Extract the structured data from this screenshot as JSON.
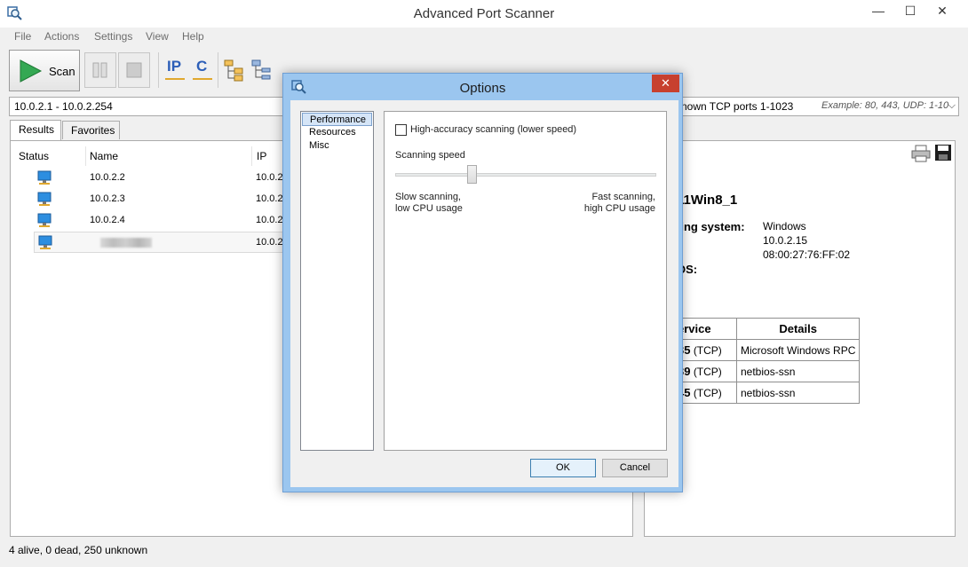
{
  "window": {
    "title": "Advanced Port Scanner",
    "controls": [
      "—",
      "☐",
      "✕"
    ]
  },
  "menu": [
    "File",
    "Actions",
    "Settings",
    "View",
    "Help"
  ],
  "toolbar": {
    "scan_label": "Scan",
    "ip_label": "IP",
    "c_label": "C"
  },
  "range": {
    "value": "10.0.2.1 - 10.0.2.254",
    "ports_text": "nown TCP ports 1-1023",
    "ports_example": "Example: 80, 443, UDP: 1-10"
  },
  "tabs": [
    "Results",
    "Favorites"
  ],
  "results": {
    "columns": [
      "Status",
      "Name",
      "IP"
    ],
    "rows": [
      {
        "name": "10.0.2.2",
        "ip": "10.0.2"
      },
      {
        "name": "10.0.2.3",
        "ip": "10.0.2"
      },
      {
        "name": "10.0.2.4",
        "ip": "10.0.2"
      },
      {
        "name": "",
        "ip": "10.0.2"
      }
    ]
  },
  "details": {
    "host": "11Win8_1",
    "os_label": "ting system:",
    "os_value": "Windows",
    "ip_value": "10.0.2.15",
    "mac_value": "08:00:27:76:FF:02",
    "dns_label": "OS:",
    "table_headers": [
      "ervice",
      "Details"
    ],
    "services": [
      {
        "port": "35",
        "proto": "(TCP)",
        "details": "Microsoft Windows RPC"
      },
      {
        "port": "39",
        "proto": "(TCP)",
        "details": "netbios-ssn"
      },
      {
        "port": "45",
        "proto": "(TCP)",
        "details": "netbios-ssn"
      }
    ]
  },
  "status": "4 alive, 0 dead, 250 unknown",
  "dialog": {
    "title": "Options",
    "close": "✕",
    "nav": [
      "Performance",
      "Resources",
      "Misc"
    ],
    "high_accuracy": "High-accuracy scanning (lower speed)",
    "speed_label": "Scanning speed",
    "slow_line1": "Slow scanning,",
    "slow_line2": "low CPU usage",
    "fast_line1": "Fast scanning,",
    "fast_line2": "high CPU usage",
    "ok": "OK",
    "cancel": "Cancel"
  }
}
